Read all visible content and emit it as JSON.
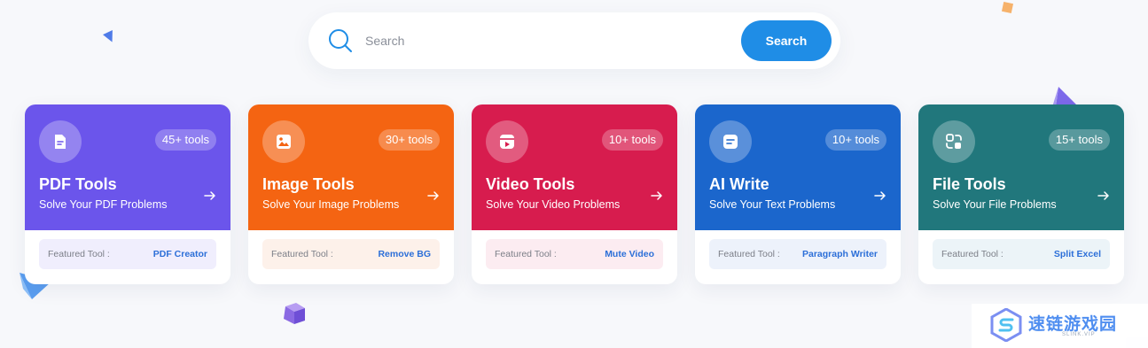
{
  "search": {
    "placeholder": "Search",
    "button_label": "Search",
    "accent": "#1f8de6"
  },
  "cards": [
    {
      "title": "PDF Tools",
      "subtitle": "Solve Your PDF Problems",
      "badge": "45+ tools",
      "icon": "pdf-document-icon",
      "color": "#6b55eb",
      "featured_label": "Featured Tool :",
      "featured_tool": "PDF Creator",
      "featured_bg": "#f0eefd"
    },
    {
      "title": "Image Tools",
      "subtitle": "Solve Your Image Problems",
      "badge": "30+ tools",
      "icon": "image-icon",
      "color": "#f46412",
      "featured_label": "Featured Tool :",
      "featured_tool": "Remove BG",
      "featured_bg": "#fdf1ea"
    },
    {
      "title": "Video Tools",
      "subtitle": "Solve Your Video Problems",
      "badge": "10+ tools",
      "icon": "video-play-icon",
      "color": "#d71c4e",
      "featured_label": "Featured Tool :",
      "featured_tool": "Mute Video",
      "featured_bg": "#fcecf1"
    },
    {
      "title": "AI Write",
      "subtitle": "Solve Your Text Problems",
      "badge": "10+ tools",
      "icon": "text-document-icon",
      "color": "#1b66cc",
      "featured_label": "Featured Tool :",
      "featured_tool": "Paragraph Writer",
      "featured_bg": "#edf2fb"
    },
    {
      "title": "File Tools",
      "subtitle": "Solve Your File Problems",
      "badge": "15+ tools",
      "icon": "file-convert-icon",
      "color": "#21777c",
      "featured_label": "Featured Tool :",
      "featured_tool": "Split Excel",
      "featured_bg": "#ecf4f8"
    }
  ],
  "watermark": {
    "text": "速链游戏园",
    "subtext": "SLINK.VIP"
  }
}
